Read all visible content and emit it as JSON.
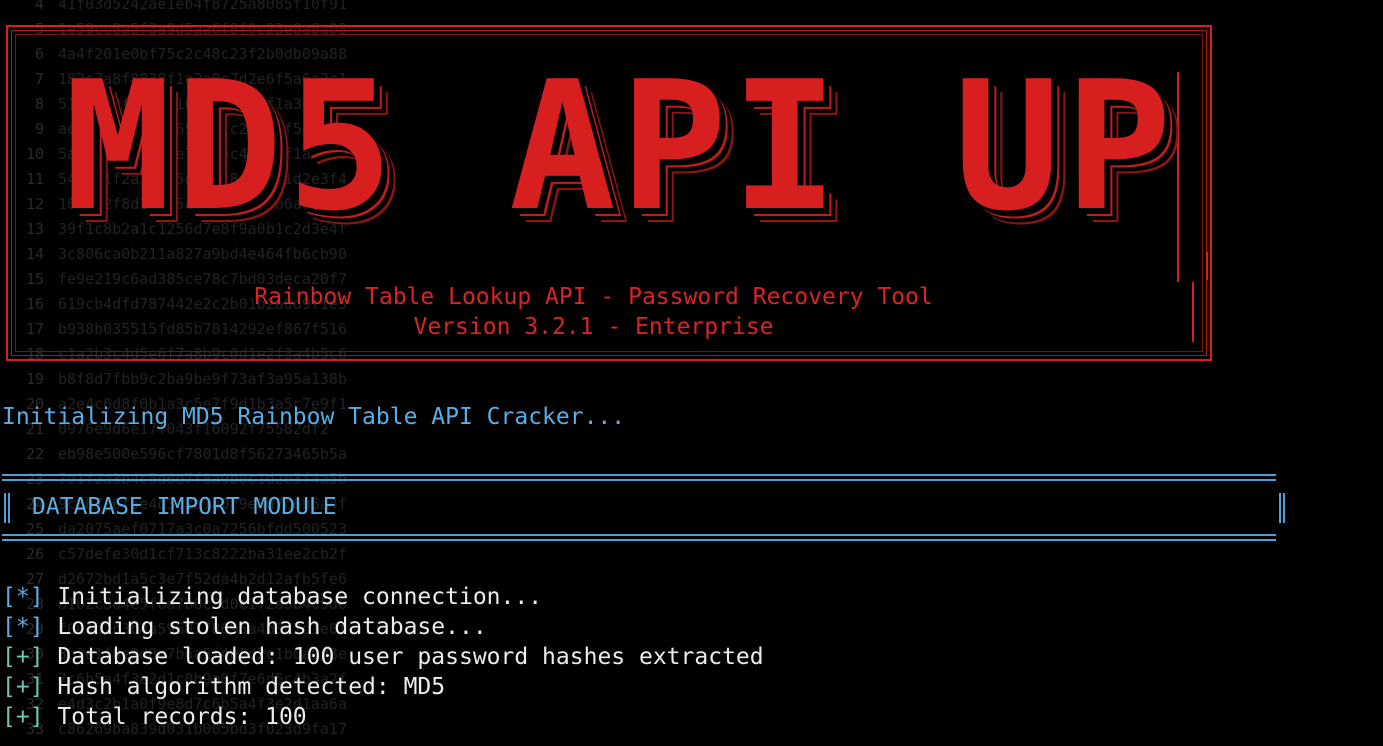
{
  "theme": {
    "background": "#000000",
    "banner_red": "#d81f1f",
    "info_blue": "#5aaee6",
    "ok_teal": "#6cc8b4",
    "text_white": "#ececec"
  },
  "background_lines": [
    {
      "n": "4",
      "hash": "41f03d5242ae1eb4f8725a8085f10f91"
    },
    {
      "n": "5",
      "hash": "1e59cc8a5f3a9d5aa6f8f0c23e8a8a03"
    },
    {
      "n": "6",
      "hash": "4a4f201e0bf75c2c48c23f2b0db09a88"
    },
    {
      "n": "7",
      "hash": "182c7a8f8838f1a2a0c7d2e6f5a6a2c1"
    },
    {
      "n": "8",
      "hash": "519b6c2f29e0a1b3d7c48e2f1a3c6d7e"
    },
    {
      "n": "9",
      "hash": "ae0d41b2c8f7e65a0b1c2d3e4f5a6b7c"
    },
    {
      "n": "10",
      "hash": "5a9e3c2b1d0f8e7a6b5c4d3e2f1a0b9c"
    },
    {
      "n": "11",
      "hash": "5430e1f2a3b4c5d6e7f8a9b0c1d2e3f4"
    },
    {
      "n": "12",
      "hash": "10a4e2f8d1c3b5a7e9f0d2c4b6a8e0f2"
    },
    {
      "n": "13",
      "hash": "39f1c8b2a1c1256d7e8f9a0b1c2d3e4f"
    },
    {
      "n": "14",
      "hash": "3c806ca0b211a827a9bd4e464fb6cb90"
    },
    {
      "n": "15",
      "hash": "fe9e219c6ad385ce78c7bd03deca20f7"
    },
    {
      "n": "16",
      "hash": "619cb4dfd787442e2c2b01b2a0d9f1e3"
    },
    {
      "n": "17",
      "hash": "b938b035515fd85b7814292ef867f516"
    },
    {
      "n": "18",
      "hash": "c1a2b3c4d5e6f7a8b9c0d1e2f3a4b5c6"
    },
    {
      "n": "19",
      "hash": "b8f8d7fbb9c2ba9be9f73af3a95a138b"
    },
    {
      "n": "20",
      "hash": "a2e4c6d8f0b1a3c5e7f9d1b3a5c7e9f1"
    },
    {
      "n": "21",
      "hash": "0976e9d6e17f043f16092f75582df2"
    },
    {
      "n": "22",
      "hash": "eb98e500e596cf7801d8f56273465b5a"
    },
    {
      "n": "23",
      "hash": "7e1f2a3b4c5d6e7f8a9b0c1d2e3f4a5b"
    },
    {
      "n": "24",
      "hash": "9c8b7a6f5e4d3c2b1a0f9e8d7c6b5a4f"
    },
    {
      "n": "25",
      "hash": "da2075aef0717a3c0a7256bfdd500523"
    },
    {
      "n": "26",
      "hash": "c57defe30d1cf713c8222ba31ee2cb2f"
    },
    {
      "n": "27",
      "hash": "d2672bd1a5c3e7f52da4b2d12afb5fe6"
    },
    {
      "n": "28",
      "hash": "a1b2c3d4e5f6a7b8c9d0e1f2a3b4c5d6"
    },
    {
      "n": "29",
      "hash": "f0e1d2c3b4a5968778695a4b3c2d1e0f"
    },
    {
      "n": "30",
      "hash": "3b2a1f0e9d8c7b6a5f4e3d2c1b0a9f8e"
    },
    {
      "n": "31",
      "hash": "7c6b5a4f3e2d1c0b9a8f7e6d5c4b3a2f"
    },
    {
      "n": "32",
      "hash": "e4d3c2b1a0f9e8d7c6b5a4f3e2d1aa6a"
    },
    {
      "n": "33",
      "hash": "c86269ba839d031b005bd3f023d9fa17"
    }
  ],
  "banner": {
    "title": "MD5 API UP",
    "subtitle": "Rainbow Table Lookup API - Password Recovery Tool",
    "version": "Version 3.2.1 - Enterprise"
  },
  "init_message": "Initializing MD5 Rainbow Table API Cracker...",
  "module": {
    "title": "DATABASE IMPORT MODULE"
  },
  "log": [
    {
      "tag": "[*]",
      "kind": "info",
      "text": "Initializing database connection..."
    },
    {
      "tag": "[*]",
      "kind": "info",
      "text": "Loading stolen hash database..."
    },
    {
      "tag": "[+]",
      "kind": "ok",
      "text": "Database loaded: 100 user password hashes extracted"
    },
    {
      "tag": "[+]",
      "kind": "ok",
      "text": "Hash algorithm detected: MD5"
    },
    {
      "tag": "[+]",
      "kind": "ok",
      "text": "Total records: 100"
    }
  ]
}
